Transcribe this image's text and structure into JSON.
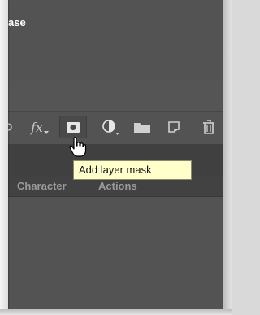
{
  "panel": {
    "partial_label": "ase"
  },
  "toolbar": {
    "fx_label": "fx",
    "icons": [
      "link-icon",
      "fx-icon",
      "layer-mask-icon",
      "adjustment-layer-icon",
      "folder-icon",
      "new-layer-icon",
      "trash-icon"
    ]
  },
  "tooltip": {
    "text": "Add layer mask"
  },
  "tabs": [
    {
      "label": "Character"
    },
    {
      "label": "Actions"
    }
  ],
  "colors": {
    "panel_bg": "#535353",
    "tab_bar_bg": "#424242",
    "tooltip_bg": "#ffffcc",
    "icon_color": "#c9c9c9"
  }
}
